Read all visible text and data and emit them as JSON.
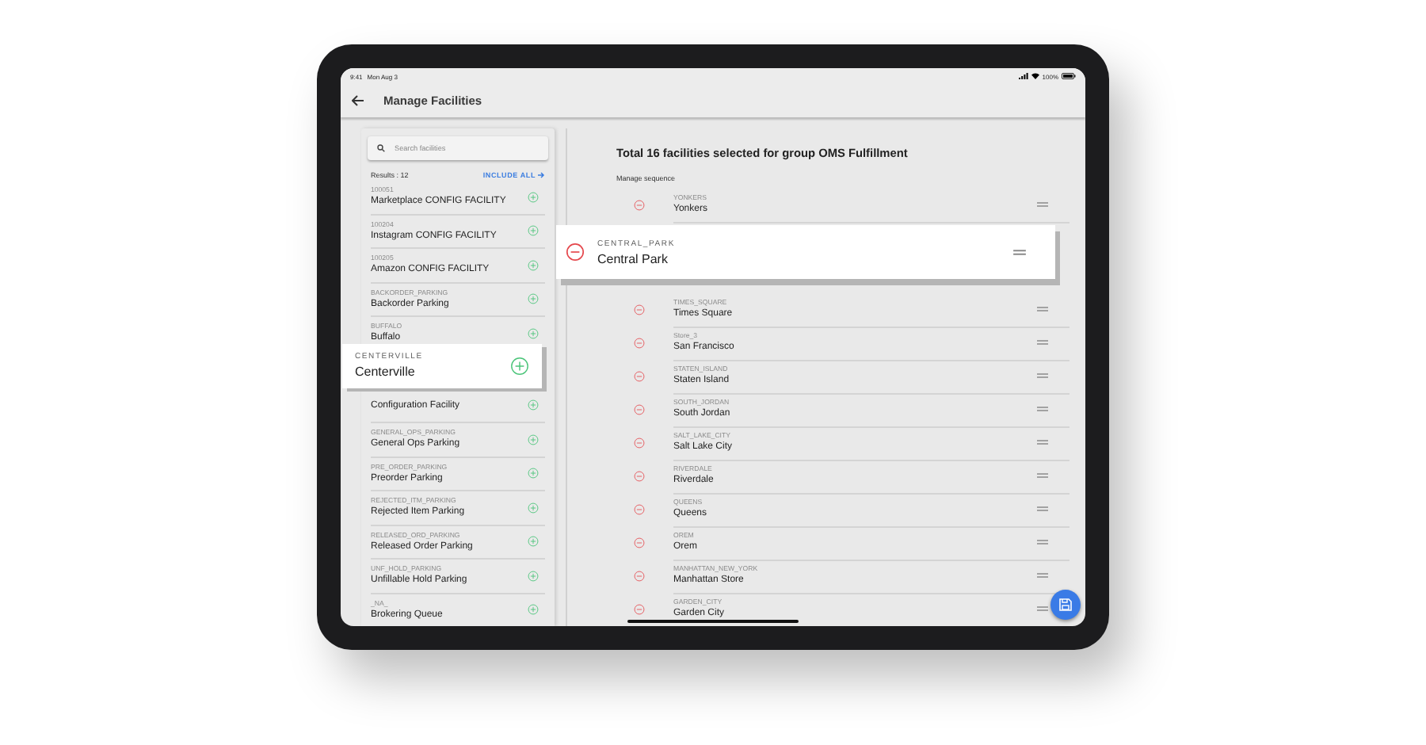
{
  "status_bar": {
    "time": "9:41",
    "date": "Mon Aug 3",
    "battery": "100%"
  },
  "header": {
    "title": "Manage Facilities"
  },
  "search": {
    "placeholder": "Search facilities"
  },
  "results": "Results : 12",
  "include_all": "INCLUDE ALL",
  "available": [
    {
      "id": "100051",
      "name": "Marketplace CONFIG FACILITY"
    },
    {
      "id": "100204",
      "name": "Instagram CONFIG FACILITY"
    },
    {
      "id": "100205",
      "name": "Amazon CONFIG FACILITY"
    },
    {
      "id": "BACKORDER_PARKING",
      "name": "Backorder Parking"
    },
    {
      "id": "BUFFALO",
      "name": "Buffalo"
    },
    {
      "name": "Configuration Facility"
    },
    {
      "id": "GENERAL_OPS_PARKING",
      "name": "General Ops Parking"
    },
    {
      "id": "PRE_ORDER_PARKING",
      "name": "Preorder Parking"
    },
    {
      "id": "REJECTED_ITM_PARKING",
      "name": "Rejected Item Parking"
    },
    {
      "id": "RELEASED_ORD_PARKING",
      "name": "Released Order Parking"
    },
    {
      "id": "UNF_HOLD_PARKING",
      "name": "Unfillable Hold Parking"
    },
    {
      "id": "_NA_",
      "name": "Brokering Queue"
    }
  ],
  "dragged_available": {
    "id": "CENTERVILLE",
    "name": "Centerville"
  },
  "selected_title": "Total 16 facilities selected for group OMS Fulfillment",
  "sequence_label": "Manage sequence",
  "sequence": [
    {
      "id": "YONKERS",
      "name": "Yonkers",
      "kind": "row"
    },
    {
      "id": "CENTRAL_PARK",
      "name": "Central Park",
      "kind": "dragged"
    },
    {
      "id": "TIMES_SQUARE",
      "name": "Times Square",
      "kind": "row"
    },
    {
      "id": "Store_3",
      "name": "San Francisco",
      "kind": "row"
    },
    {
      "id": "STATEN_ISLAND",
      "name": "Staten Island",
      "kind": "row"
    },
    {
      "id": "SOUTH_JORDAN",
      "name": "South Jordan",
      "kind": "row"
    },
    {
      "id": "SALT_LAKE_CITY",
      "name": "Salt Lake City",
      "kind": "row"
    },
    {
      "id": "RIVERDALE",
      "name": "Riverdale",
      "kind": "row"
    },
    {
      "id": "QUEENS",
      "name": "Queens",
      "kind": "row"
    },
    {
      "id": "OREM",
      "name": "Orem",
      "kind": "row"
    },
    {
      "id": "MANHATTAN_NEW_YORK",
      "name": "Manhattan Store",
      "kind": "row"
    },
    {
      "id": "GARDEN_CITY",
      "name": "Garden City",
      "kind": "row"
    }
  ]
}
